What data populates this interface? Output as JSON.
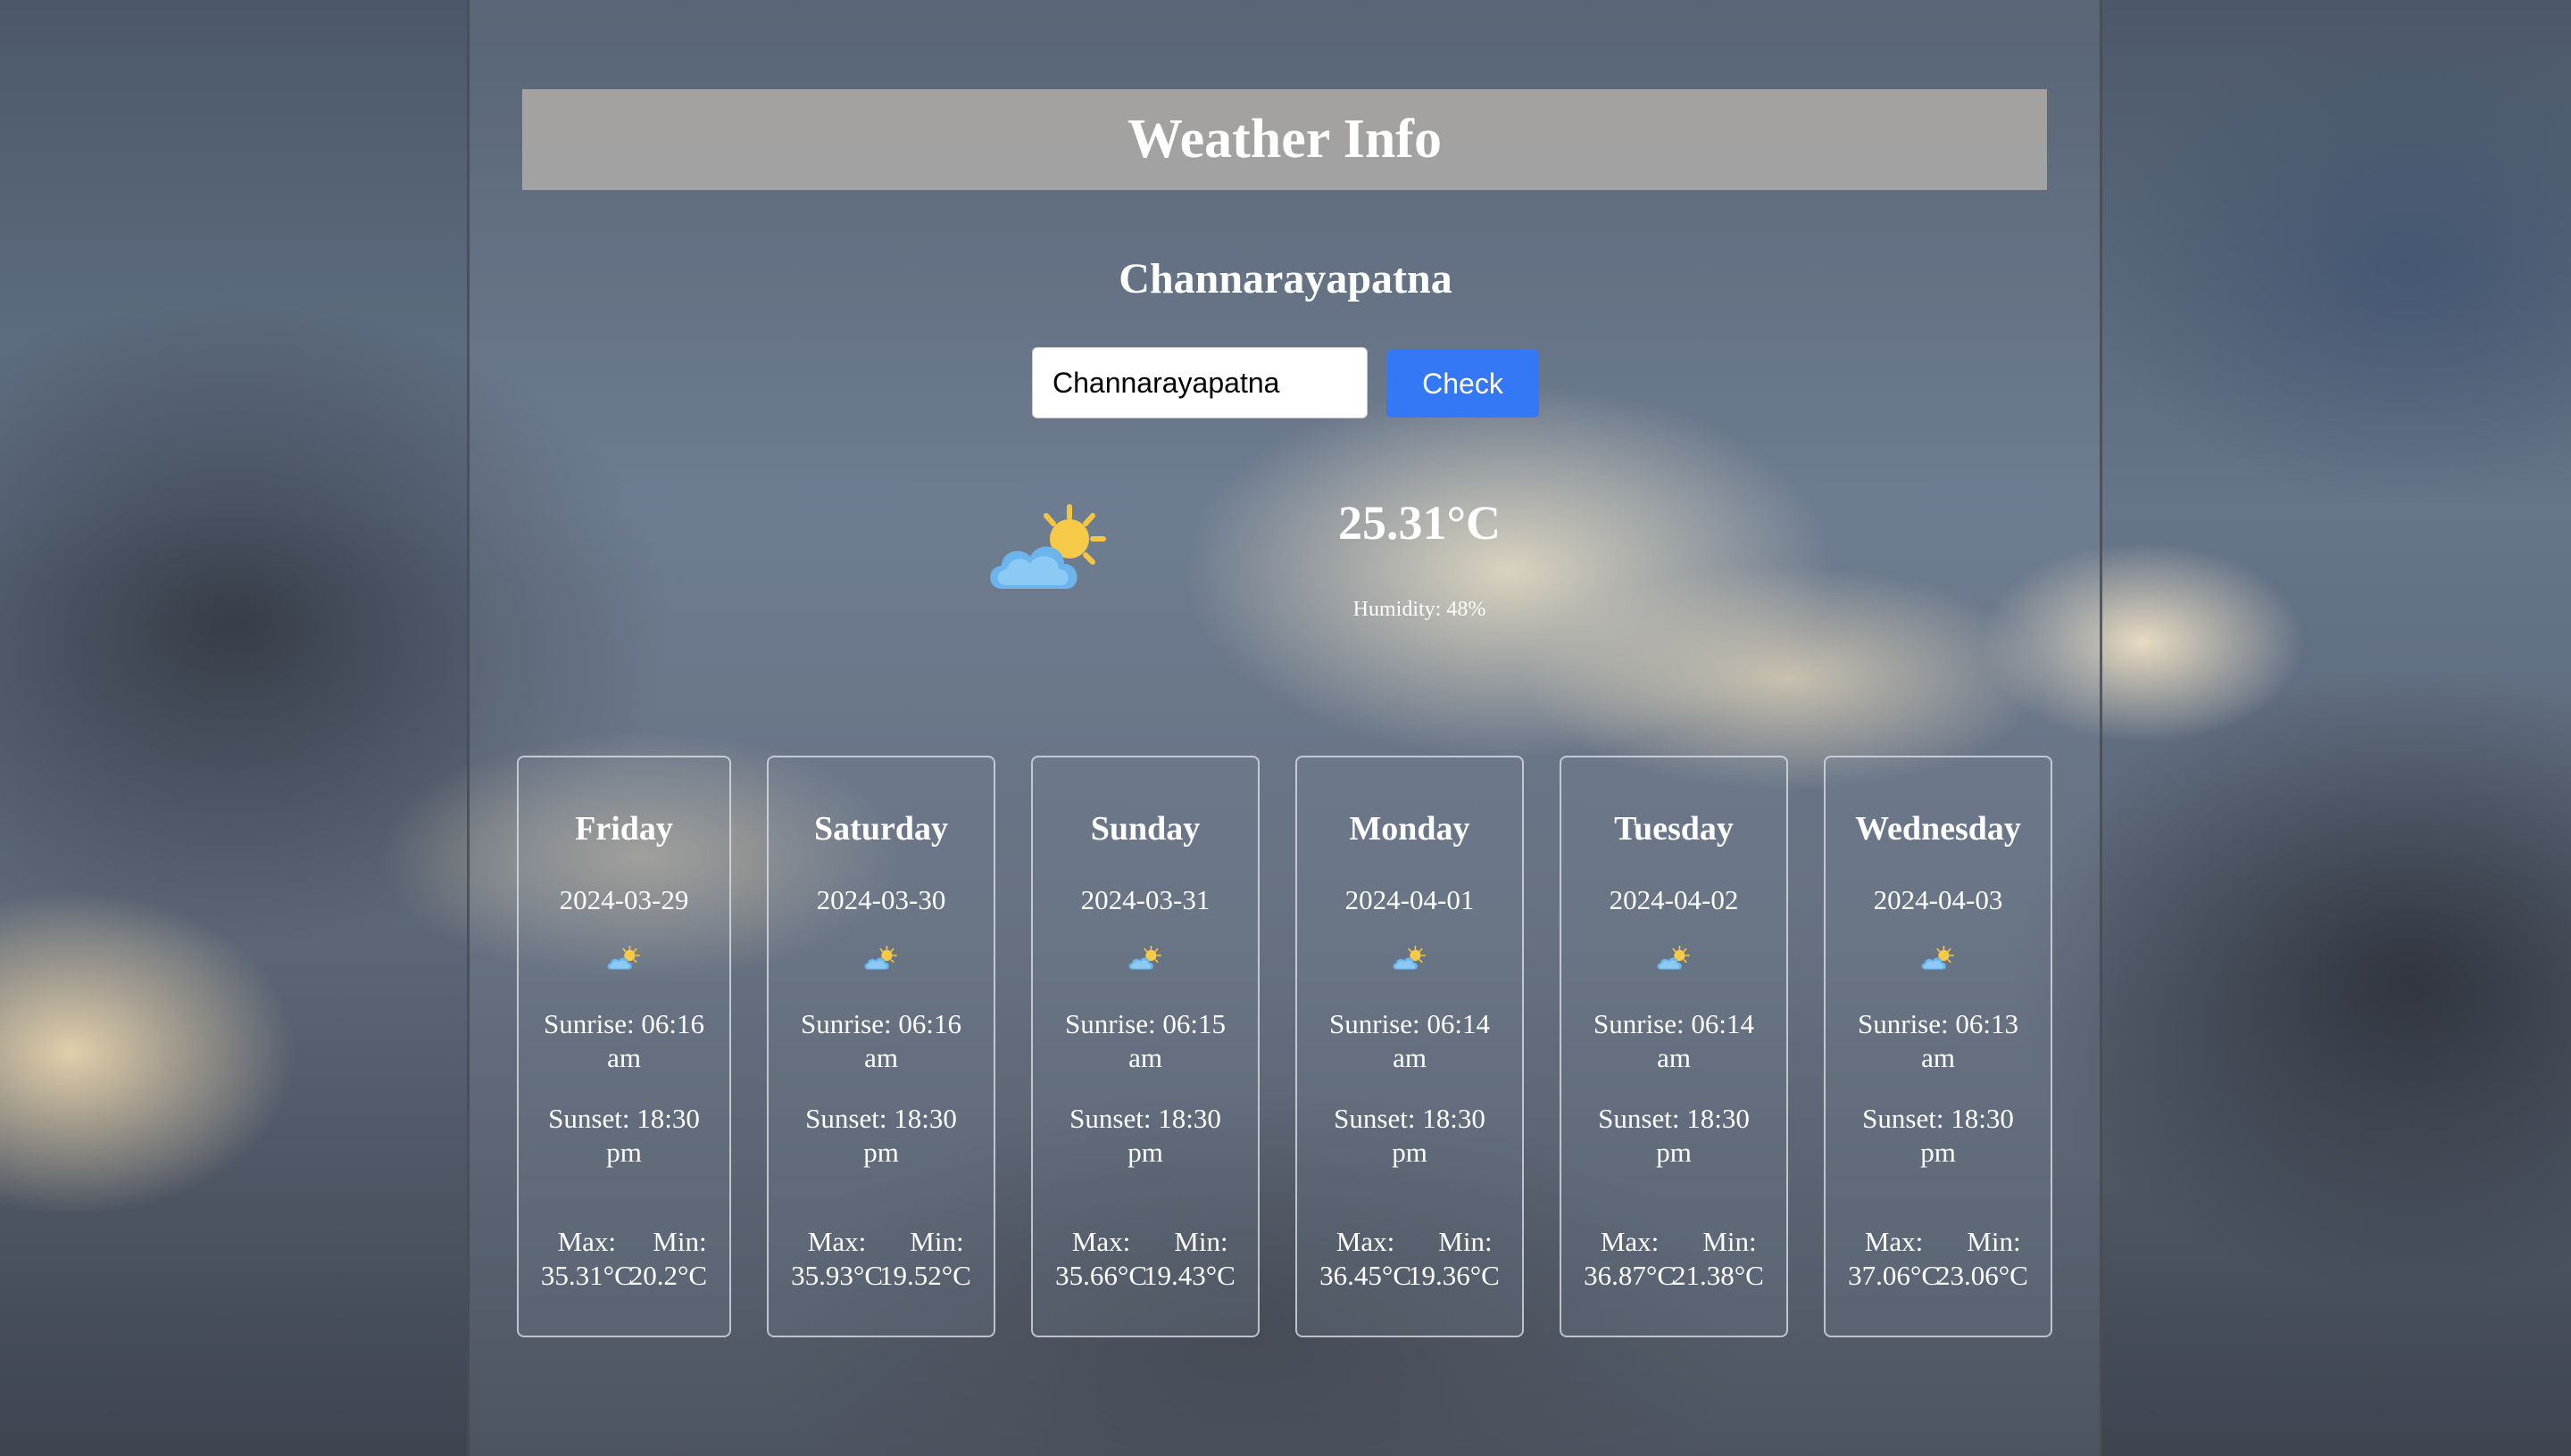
{
  "header": {
    "title": "Weather Info"
  },
  "current": {
    "city": "Channarayapatna",
    "temperature": "25.31°C",
    "humidity": "Humidity: 48%",
    "icon": "partly-cloudy-icon"
  },
  "search": {
    "value": "Channarayapatna",
    "button_label": "Check"
  },
  "forecast": [
    {
      "day": "Friday",
      "date": "2024-03-29",
      "sunrise": "Sunrise: 06:16 am",
      "sunset": "Sunset: 18:30 pm",
      "max_label": "Max:",
      "min_label": "Min:",
      "max": "35.31°C",
      "min": "20.2°C",
      "icon": "partly-cloudy-icon"
    },
    {
      "day": "Saturday",
      "date": "2024-03-30",
      "sunrise": "Sunrise: 06:16 am",
      "sunset": "Sunset: 18:30 pm",
      "max_label": "Max:",
      "min_label": "Min:",
      "max": "35.93°C",
      "min": "19.52°C",
      "icon": "partly-cloudy-icon"
    },
    {
      "day": "Sunday",
      "date": "2024-03-31",
      "sunrise": "Sunrise: 06:15 am",
      "sunset": "Sunset: 18:30 pm",
      "max_label": "Max:",
      "min_label": "Min:",
      "max": "35.66°C",
      "min": "19.43°C",
      "icon": "partly-cloudy-icon"
    },
    {
      "day": "Monday",
      "date": "2024-04-01",
      "sunrise": "Sunrise: 06:14 am",
      "sunset": "Sunset: 18:30 pm",
      "max_label": "Max:",
      "min_label": "Min:",
      "max": "36.45°C",
      "min": "19.36°C",
      "icon": "partly-cloudy-icon"
    },
    {
      "day": "Tuesday",
      "date": "2024-04-02",
      "sunrise": "Sunrise: 06:14 am",
      "sunset": "Sunset: 18:30 pm",
      "max_label": "Max:",
      "min_label": "Min:",
      "max": "36.87°C",
      "min": "21.38°C",
      "icon": "partly-cloudy-icon"
    },
    {
      "day": "Wednesday",
      "date": "2024-04-03",
      "sunrise": "Sunrise: 06:13 am",
      "sunset": "Sunset: 18:30 pm",
      "max_label": "Max:",
      "min_label": "Min:",
      "max": "37.06°C",
      "min": "23.06°C",
      "icon": "partly-cloudy-icon"
    }
  ],
  "colors": {
    "button": "#3478f6",
    "header_bar": "#a8a6a3",
    "sun": "#f7c948",
    "cloud": "#6cb4ec"
  }
}
